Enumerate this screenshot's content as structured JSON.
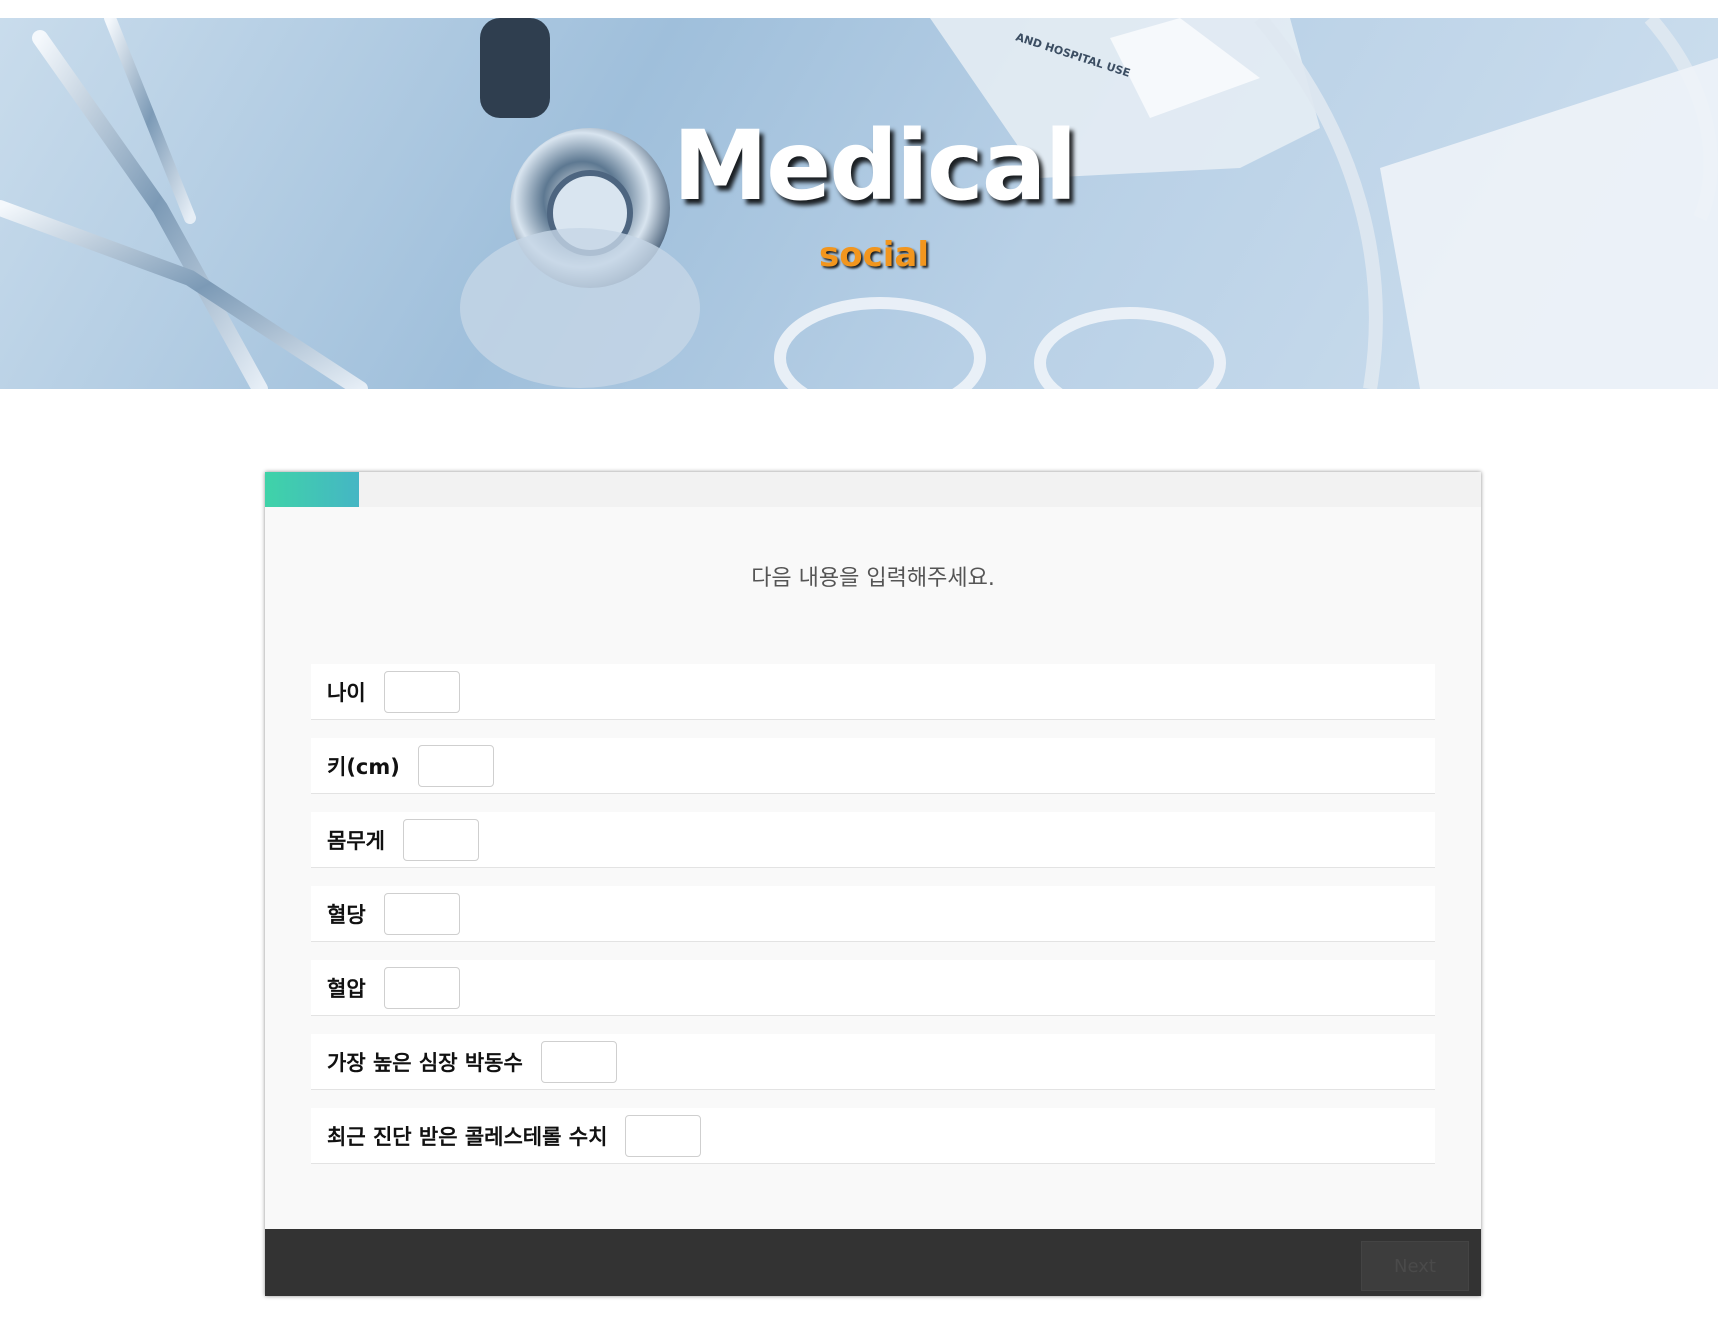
{
  "hero": {
    "title": "Medical",
    "subtitle": "social",
    "tray_text": "AND HOSPITAL USE"
  },
  "progress": {
    "fraction": 0.077
  },
  "form": {
    "instruction": "다음 내용을 입력해주세요.",
    "fields": [
      {
        "label": "나이",
        "value": ""
      },
      {
        "label": "키(cm)",
        "value": ""
      },
      {
        "label": "몸무게",
        "value": ""
      },
      {
        "label": "혈당",
        "value": ""
      },
      {
        "label": "혈압",
        "value": ""
      },
      {
        "label": "가장 높은 심장 박동수",
        "value": ""
      },
      {
        "label": "최근 진단 받은 콜레스테롤 수치",
        "value": ""
      }
    ]
  },
  "footer": {
    "next_label": "Next"
  },
  "colors": {
    "progress_start": "#3fd3a8",
    "progress_end": "#45b6c4",
    "subtitle": "#f2961e",
    "footer_bg": "#333333"
  }
}
